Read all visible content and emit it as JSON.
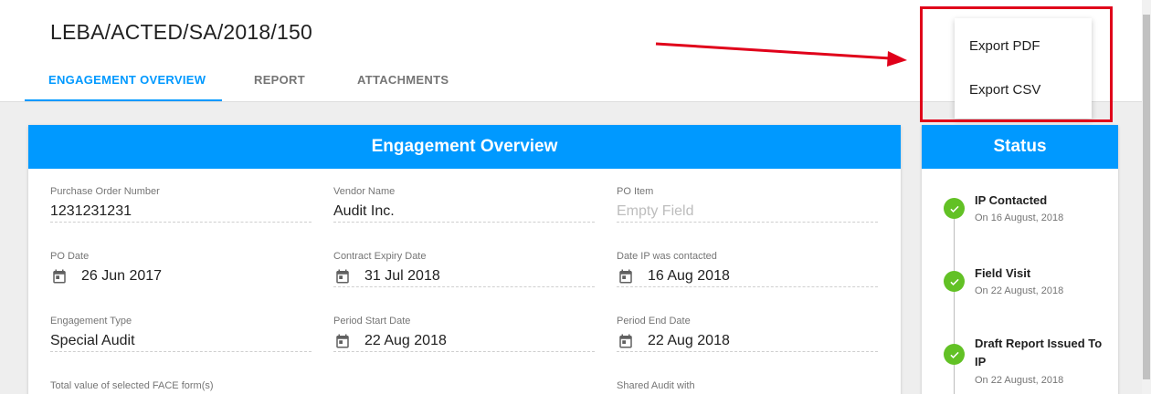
{
  "header": {
    "title": "LEBA/ACTED/SA/2018/150",
    "tabs": [
      {
        "label": "ENGAGEMENT OVERVIEW"
      },
      {
        "label": "REPORT"
      },
      {
        "label": "ATTACHMENTS"
      }
    ],
    "active_tab": "ENGAGEMENT OVERVIEW"
  },
  "export_menu": {
    "items": [
      {
        "label": "Export PDF"
      },
      {
        "label": "Export CSV"
      }
    ]
  },
  "overview": {
    "title": "Engagement Overview",
    "fields": [
      {
        "label": "Purchase Order Number",
        "value": "1231231231"
      },
      {
        "label": "Vendor Name",
        "value": "Audit Inc."
      },
      {
        "label": "PO Item",
        "value": "Empty Field"
      },
      {
        "label": "PO Date",
        "value": "26 Jun 2017"
      },
      {
        "label": "Contract Expiry Date",
        "value": "31 Jul 2018"
      },
      {
        "label": "Date IP was contacted",
        "value": "16 Aug 2018"
      },
      {
        "label": "Engagement Type",
        "value": "Special Audit"
      },
      {
        "label": "Period Start Date",
        "value": "22 Aug 2018"
      },
      {
        "label": "Period End Date",
        "value": "22 Aug 2018"
      },
      {
        "label": "Total value of selected FACE form(s)"
      },
      {
        "label": "Shared Audit with"
      }
    ]
  },
  "status": {
    "title": "Status",
    "steps": [
      {
        "title": "IP Contacted",
        "date": "On 16 August, 2018"
      },
      {
        "title": "Field Visit",
        "date": "On 22 August, 2018"
      },
      {
        "title": "Draft Report Issued To IP",
        "date": "On 22 August, 2018"
      }
    ]
  },
  "colors": {
    "accent": "#0099ff",
    "check": "#62c125",
    "annotation": "#e0001a"
  },
  "icons": [
    "calendar-icon",
    "check-icon"
  ]
}
